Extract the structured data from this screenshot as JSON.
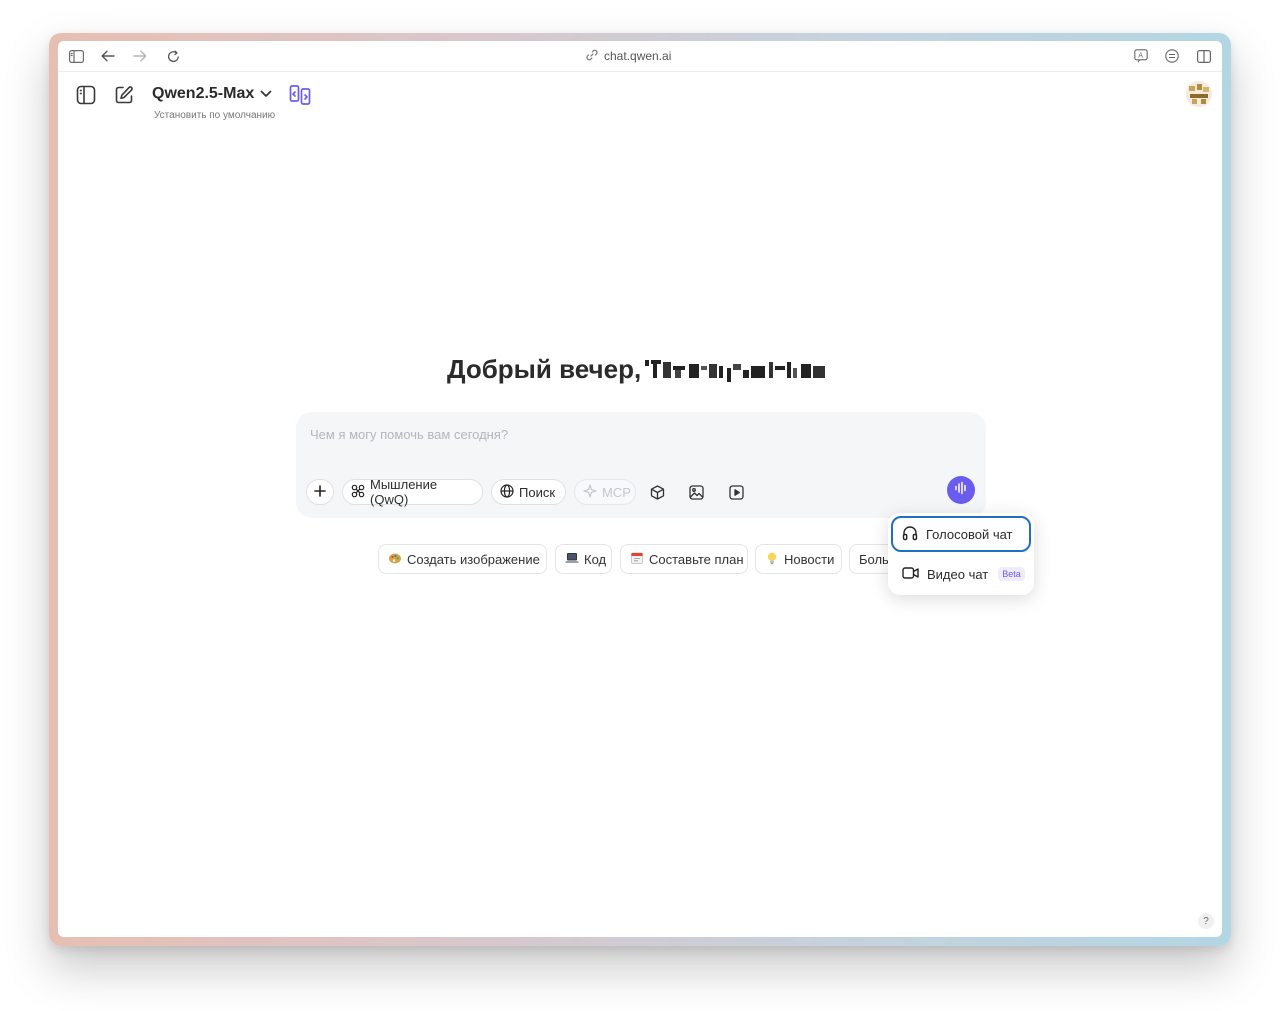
{
  "browser": {
    "url": "chat.qwen.ai"
  },
  "header": {
    "model_name": "Qwen2.5-Max",
    "set_default": "Установить по умолчанию"
  },
  "main": {
    "greeting": "Добрый вечер,"
  },
  "composer": {
    "placeholder": "Чем я могу помочь вам сегодня?",
    "chips": {
      "thinking": "Мышление (QwQ)",
      "search": "Поиск",
      "mcp": "MCP"
    }
  },
  "suggestions": [
    {
      "label": "Создать изображение",
      "icon": "palette-emoji"
    },
    {
      "label": "Код",
      "icon": "laptop-emoji"
    },
    {
      "label": "Составьте план",
      "icon": "calendar-emoji"
    },
    {
      "label": "Новости",
      "icon": "lightbulb-emoji"
    },
    {
      "label": "Больше",
      "icon": ""
    }
  ],
  "voice_menu": {
    "voice_chat": "Голосовой чат",
    "video_chat": "Видео чат",
    "beta": "Beta"
  },
  "help": {
    "label": "?"
  },
  "colors": {
    "accent": "#6b5cf0",
    "focus_ring": "#1f6fc6"
  }
}
